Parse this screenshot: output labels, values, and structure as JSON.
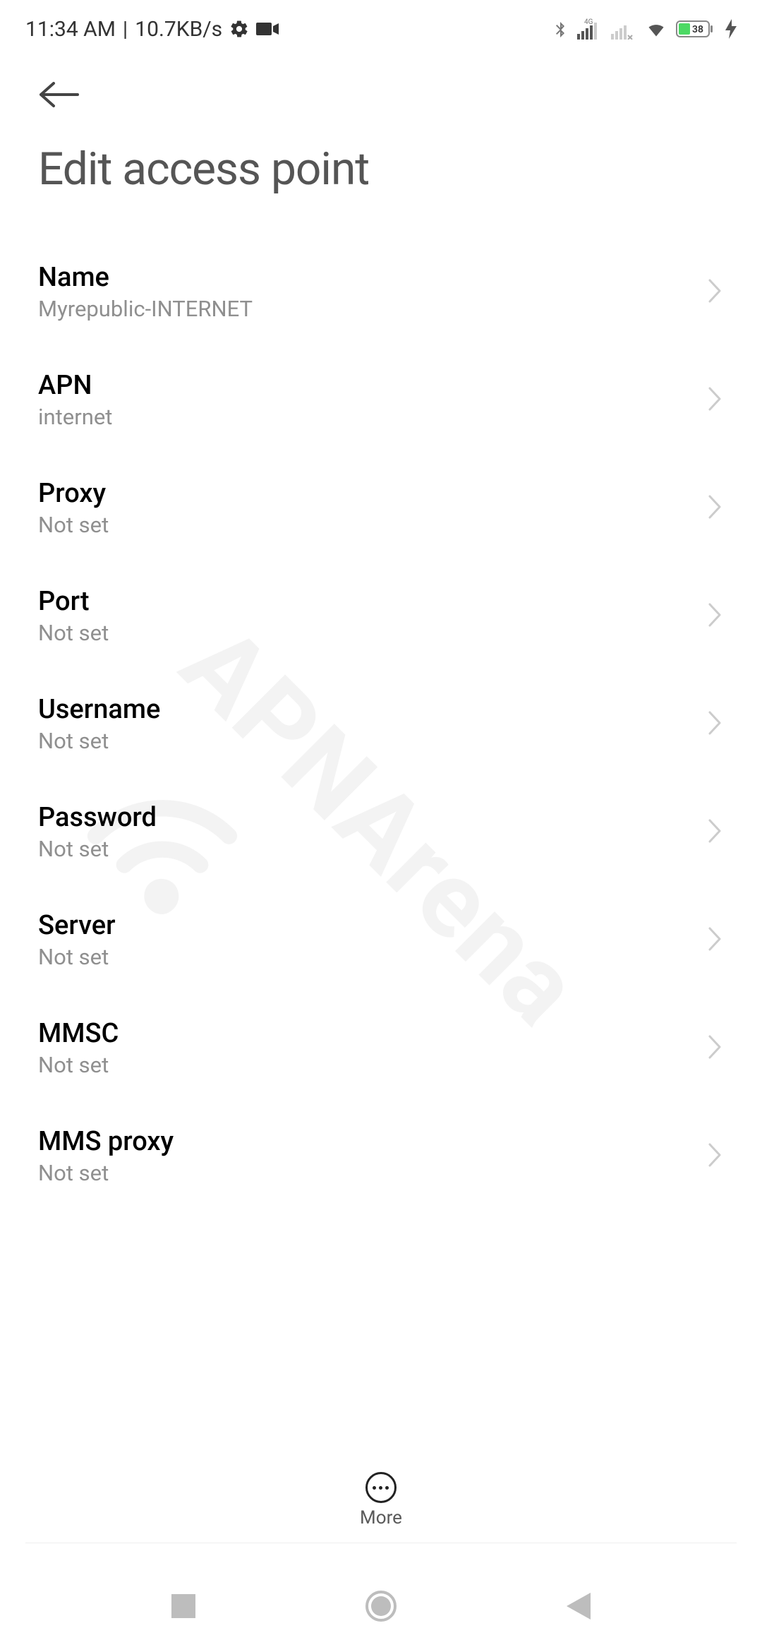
{
  "status": {
    "time": "11:34 AM",
    "divider": "|",
    "speed": "10.7KB/s",
    "battery": "38"
  },
  "header": {
    "title": "Edit access point"
  },
  "settings": [
    {
      "label": "Name",
      "value": "Myrepublic-INTERNET"
    },
    {
      "label": "APN",
      "value": "internet"
    },
    {
      "label": "Proxy",
      "value": "Not set"
    },
    {
      "label": "Port",
      "value": "Not set"
    },
    {
      "label": "Username",
      "value": "Not set"
    },
    {
      "label": "Password",
      "value": "Not set"
    },
    {
      "label": "Server",
      "value": "Not set"
    },
    {
      "label": "MMSC",
      "value": "Not set"
    },
    {
      "label": "MMS proxy",
      "value": "Not set"
    }
  ],
  "bottom": {
    "more": "More"
  },
  "watermark": "APNArena"
}
